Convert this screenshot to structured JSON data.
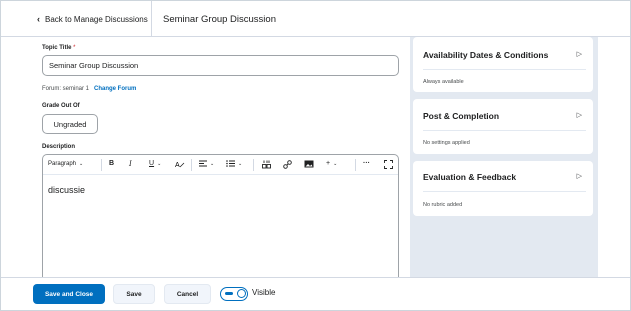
{
  "header": {
    "back_label": "Back to Manage Discussions",
    "title": "Seminar Group Discussion"
  },
  "form": {
    "topic_title_label": "Topic Title",
    "required_marker": "*",
    "topic_title_value": "Seminar Group Discussion",
    "forum_label": "Forum: seminar 1",
    "change_forum_label": "Change Forum",
    "grade_label": "Grade Out Of",
    "grade_value": "Ungraded",
    "description_label": "Description"
  },
  "editor": {
    "paragraph_label": "Paragraph",
    "bold_glyph": "B",
    "italic_glyph": "I",
    "underline_glyph": "U",
    "more_glyph": "···",
    "body_text": "discussie"
  },
  "sidebar": {
    "panels": [
      {
        "title": "Availability Dates & Conditions",
        "subtitle": "Always available"
      },
      {
        "title": "Post & Completion",
        "subtitle": "No settings applied"
      },
      {
        "title": "Evaluation & Feedback",
        "subtitle": "No rubric added"
      }
    ]
  },
  "footer": {
    "save_close_label": "Save and Close",
    "save_label": "Save",
    "cancel_label": "Cancel",
    "visible_label": "Visible"
  },
  "colors": {
    "primary": "#006fbf",
    "sidebar_bg": "#e3e9f1",
    "required": "#cd2026"
  }
}
